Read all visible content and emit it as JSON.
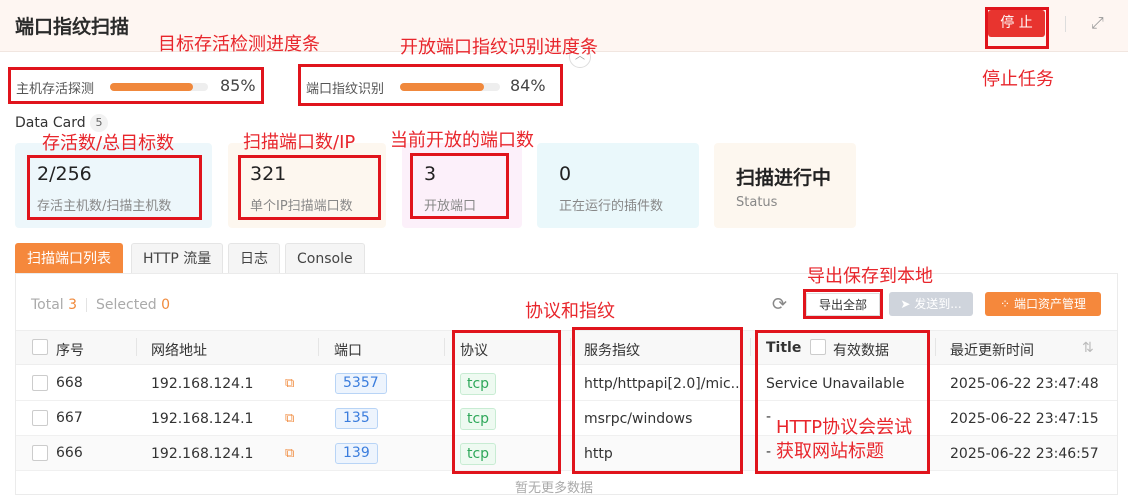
{
  "header": {
    "title": "端口指纹扫描",
    "stop_label": "停 止",
    "expand_icon": "expand-icon"
  },
  "progress": [
    {
      "label": "主机存活探测",
      "percent": 85,
      "percent_text": "85%"
    },
    {
      "label": "端口指纹识别",
      "percent": 84,
      "percent_text": "84%"
    }
  ],
  "data_card": {
    "title": "Data Card",
    "count": "5",
    "cards": [
      {
        "value": "2/256",
        "desc": "存活主机数/扫描主机数",
        "bg": "#edf7fb"
      },
      {
        "value": "321",
        "desc": "单个IP扫描端口数",
        "bg": "#fdf7ef"
      },
      {
        "value": "3",
        "desc": "开放端口",
        "bg": "#fcf0fa"
      },
      {
        "value": "0",
        "desc": "正在运行的插件数",
        "bg": "#eaf8fb"
      },
      {
        "value": "扫描进行中",
        "desc": "Status",
        "bg": "#fdf7ef"
      }
    ]
  },
  "tabs": [
    "扫描端口列表",
    "HTTP 流量",
    "日志",
    "Console"
  ],
  "toolbar": {
    "total_label": "Total",
    "total": "3",
    "selected_label": "Selected",
    "selected": "0",
    "export_label": "导出全部",
    "send_label": "发送到...",
    "manage_label": "端口资产管理"
  },
  "table": {
    "headers": [
      "序号",
      "网络地址",
      "端口",
      "协议",
      "服务指纹",
      "Title",
      "有效数据",
      "最近更新时间"
    ],
    "rows": [
      {
        "id": "668",
        "ip": "192.168.124.1",
        "port": "5357",
        "proto": "tcp",
        "fp": "http/httpapi[2.0]/mic...",
        "title": "Service Unavailable",
        "time": "2025-06-22 23:47:48"
      },
      {
        "id": "667",
        "ip": "192.168.124.1",
        "port": "135",
        "proto": "tcp",
        "fp": "msrpc/windows",
        "title": "-",
        "time": "2025-06-22 23:47:15"
      },
      {
        "id": "666",
        "ip": "192.168.124.1",
        "port": "139",
        "proto": "tcp",
        "fp": "http",
        "title": "-",
        "time": "2025-06-22 23:46:57"
      }
    ],
    "empty_text": "暂无更多数据"
  },
  "annotations": {
    "a1": "目标存活检测进度条",
    "a2": "开放端口指纹识别进度条",
    "a3": "停止任务",
    "a4": "存活数/总目标数",
    "a5": "扫描端口数/IP",
    "a6": "当前开放的端口数",
    "a7": "导出保存到本地",
    "a8": "协议和指纹",
    "a9_line1": "HTTP协议会尝试",
    "a9_line2": "获取网站标题"
  },
  "colors": {
    "accent": "#f5883c",
    "stop": "#e8342f",
    "annotation": "#e8262c"
  }
}
